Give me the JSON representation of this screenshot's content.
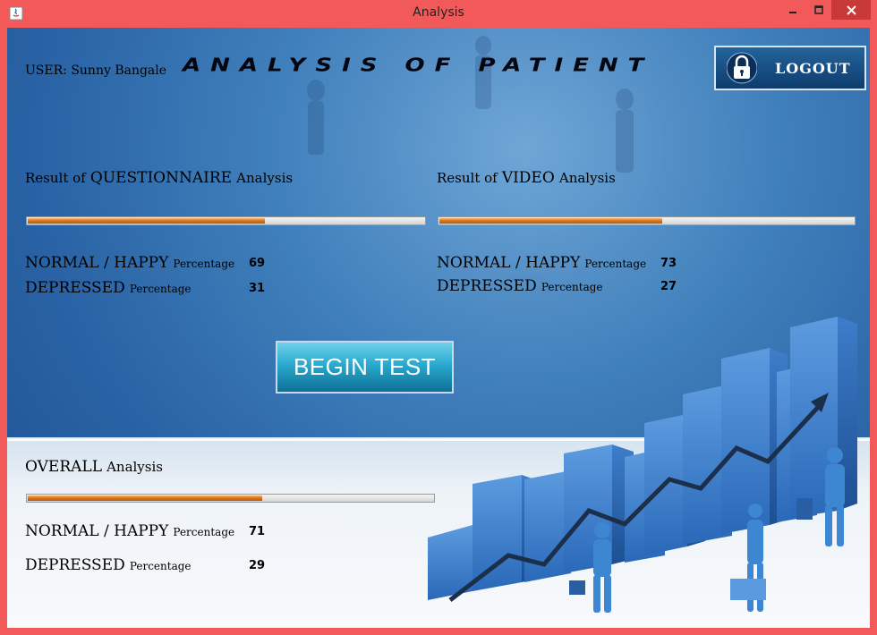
{
  "window": {
    "title": "Analysis"
  },
  "header": {
    "user_label": "USER: Sunny Bangale",
    "title": "Analysis of Patient",
    "logout_label": "LOGOUT"
  },
  "questionnaire": {
    "title_prefix": "Result of",
    "title_main": "QUESTIONNAIRE",
    "title_suffix": "Analysis",
    "progress": 0.6,
    "normal_label": "NORMAL / HAPPY",
    "normal_suffix": "Percentage",
    "normal_value": "69",
    "depressed_label": "DEPRESSED",
    "depressed_suffix": "Percentage",
    "depressed_value": "31"
  },
  "video": {
    "title_prefix": "Result of",
    "title_main": "VIDEO",
    "title_suffix": "Analysis",
    "progress": 0.54,
    "normal_label": "NORMAL / HAPPY",
    "normal_suffix": "Percentage",
    "normal_value": "73",
    "depressed_label": "DEPRESSED",
    "depressed_suffix": "Percentage",
    "depressed_value": "27"
  },
  "begin_test_label": "BEGIN TEST",
  "overall": {
    "title_main": "OVERALL",
    "title_suffix": "Analysis",
    "progress": 0.58,
    "normal_label": "NORMAL / HAPPY",
    "normal_suffix": "Percentage",
    "normal_value": "71",
    "depressed_label": "DEPRESSED",
    "depressed_suffix": "Percentage",
    "depressed_value": "29"
  },
  "colors": {
    "titlebar": "#f25a5a",
    "background_blue": "#2a64a6",
    "progress_fill": "#d9781e",
    "button_cyan": "#2aa9cf"
  },
  "icons": [
    "java-app-icon",
    "minimize-icon",
    "maximize-icon",
    "close-icon",
    "padlock-icon"
  ]
}
